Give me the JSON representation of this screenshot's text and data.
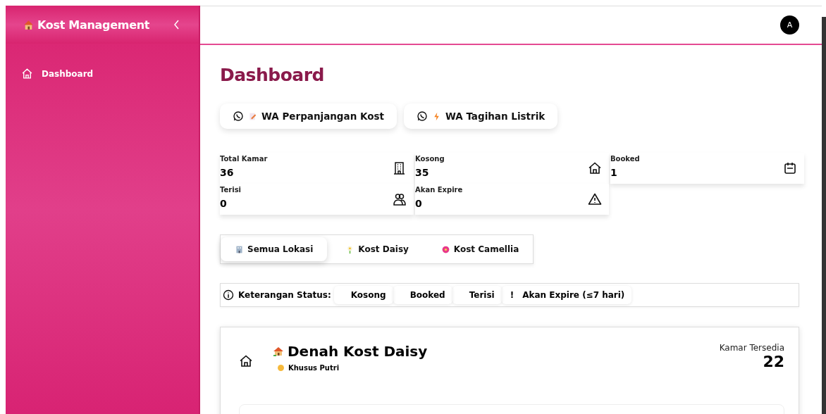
{
  "sidebar": {
    "brand": "Kost Management",
    "items": [
      {
        "label": "Dashboard",
        "selected": true
      }
    ]
  },
  "header": {
    "avatar": "A"
  },
  "page_title": "Dashboard",
  "wa_buttons": [
    {
      "kind": "note",
      "label": "WA Perpanjangan Kost"
    },
    {
      "kind": "bolt",
      "label": "WA Tagihan Listrik"
    }
  ],
  "stats": [
    {
      "kind": "building",
      "label": "Total Kamar",
      "value": "36"
    },
    {
      "kind": "house",
      "label": "Kosong",
      "value": "35"
    },
    {
      "kind": "calendar",
      "label": "Booked",
      "value": "1"
    },
    {
      "kind": "people",
      "label": "Terisi",
      "value": "0"
    },
    {
      "kind": "warning",
      "label": "Akan Expire",
      "value": "0"
    }
  ],
  "location_tabs": [
    {
      "kind": "building",
      "label": "Semua Lokasi",
      "selected": true
    },
    {
      "kind": "daisy",
      "label": "Kost Daisy",
      "selected": false
    },
    {
      "kind": "flower",
      "label": "Kost Camellia",
      "selected": false
    }
  ],
  "legend": {
    "title": "Keterangan Status:",
    "items": [
      {
        "label": "Kosong"
      },
      {
        "label": "Booked"
      },
      {
        "label": "Terisi"
      },
      {
        "mark": "!",
        "label": "Akan Expire (≤7 hari)"
      }
    ]
  },
  "floor_plan": {
    "title": "Denah Kost Daisy",
    "tag": "Khusus Putri",
    "available_label": "Kamar Tersedia",
    "available": "22"
  }
}
